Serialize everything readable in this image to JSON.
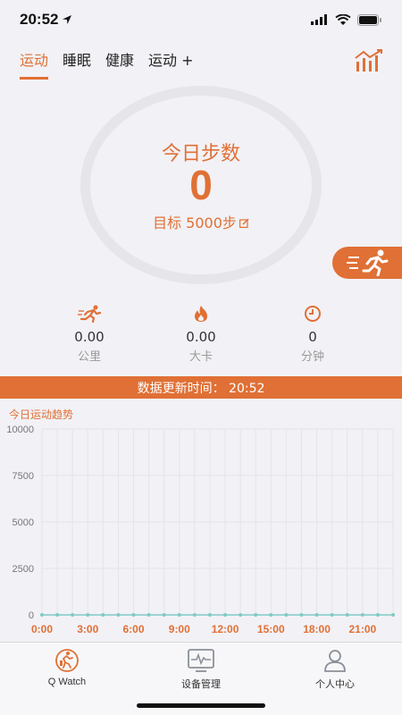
{
  "status_bar": {
    "time": "20:52"
  },
  "tabs": [
    {
      "label": "运动"
    },
    {
      "label": "睡眠"
    },
    {
      "label": "健康"
    },
    {
      "label": "运动 +"
    }
  ],
  "ring": {
    "title": "今日步数",
    "value": "0",
    "goal_label": "目标 5000步"
  },
  "stats": [
    {
      "icon": "running-icon",
      "value": "0.00",
      "unit": "公里"
    },
    {
      "icon": "flame-icon",
      "value": "0.00",
      "unit": "大卡"
    },
    {
      "icon": "clock-icon",
      "value": "0",
      "unit": "分钟"
    }
  ],
  "update_bar": {
    "text": "数据更新时间： 20:52"
  },
  "chart_title": "今日运动趋势",
  "chart_data": {
    "type": "line",
    "title": "",
    "xlabel": "",
    "ylabel": "",
    "x_tick_labels": [
      "0:00",
      "3:00",
      "6:00",
      "9:00",
      "12:00",
      "15:00",
      "18:00",
      "21:00"
    ],
    "y_tick_labels": [
      "0",
      "2500",
      "5000",
      "7500",
      "10000"
    ],
    "ylim": [
      0,
      10000
    ],
    "x": [
      0,
      1,
      2,
      3,
      4,
      5,
      6,
      7,
      8,
      9,
      10,
      11,
      12,
      13,
      14,
      15,
      16,
      17,
      18,
      19,
      20,
      21,
      22,
      23
    ],
    "series": [
      {
        "values": [
          0,
          0,
          0,
          0,
          0,
          0,
          0,
          0,
          0,
          0,
          0,
          0,
          0,
          0,
          0,
          0,
          0,
          0,
          0,
          0,
          0,
          0,
          0,
          0
        ]
      }
    ],
    "grid": true,
    "colors": {
      "line": "#80cbc4",
      "axis_labels": "#e07035",
      "grid": "#e4e4ea"
    }
  },
  "tabbar": [
    {
      "label": "Q Watch",
      "icon": "watch-icon"
    },
    {
      "label": "设备管理",
      "icon": "device-icon"
    },
    {
      "label": "个人中心",
      "icon": "person-icon"
    }
  ],
  "colors": {
    "accent": "#e07035",
    "background": "#f2f1f6"
  }
}
